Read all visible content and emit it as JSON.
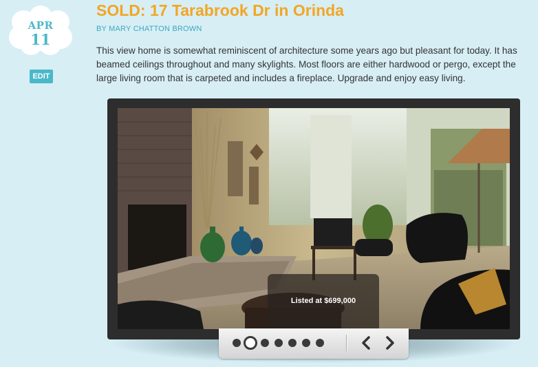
{
  "date": {
    "month": "APR",
    "day": "11"
  },
  "edit_label": "EDIT",
  "post": {
    "title": "SOLD: 17 Tarabrook Dr in Orinda",
    "author": "BY MARY CHATTON BROWN",
    "body": "This view home is somewhat reminiscent of architecture some years ago but pleasant for today. It has beamed ceilings throughout and many skylights. Most floors are either hardwood or pergo, except the large living room that is carpeted and includes a fireplace. Upgrade and enjoy easy living."
  },
  "slideshow": {
    "caption": "Listed at $699,000",
    "slide_count": 7,
    "active_index": 1,
    "prev_icon": "chevron-left-icon",
    "next_icon": "chevron-right-icon"
  },
  "colors": {
    "background": "#d7eef5",
    "title": "#f2a623",
    "accent": "#4bb8c9",
    "author": "#3aa8c0"
  }
}
